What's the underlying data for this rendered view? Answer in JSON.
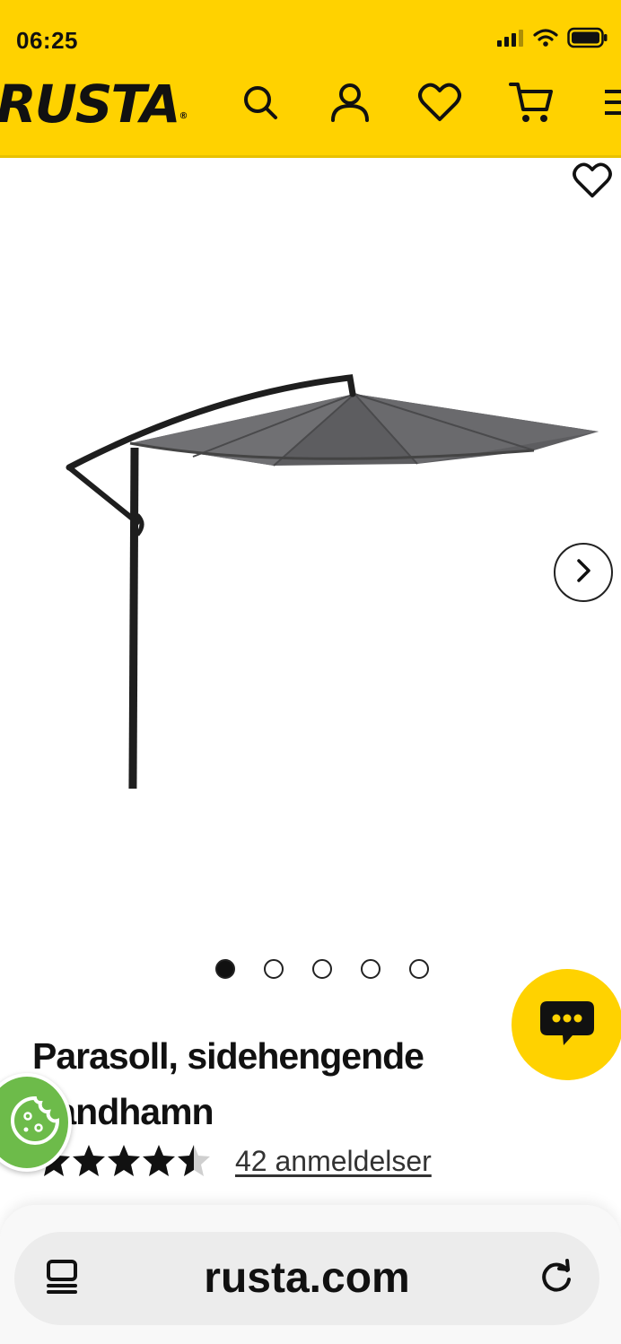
{
  "status_bar": {
    "time": "06:25"
  },
  "header": {
    "logo": "RUSTA",
    "logo_mark": "®",
    "icons": [
      "search-icon",
      "account-icon",
      "heart-icon",
      "cart-icon",
      "menu-icon"
    ],
    "brand_color": "#FFD200"
  },
  "gallery": {
    "image_count": 5,
    "active_index": 0
  },
  "product": {
    "title": "Parasoll, sidehengende Sandhamn",
    "rating": 4.5,
    "reviews_label": "42 anmeldelser"
  },
  "browser": {
    "url": "rusta.com"
  }
}
